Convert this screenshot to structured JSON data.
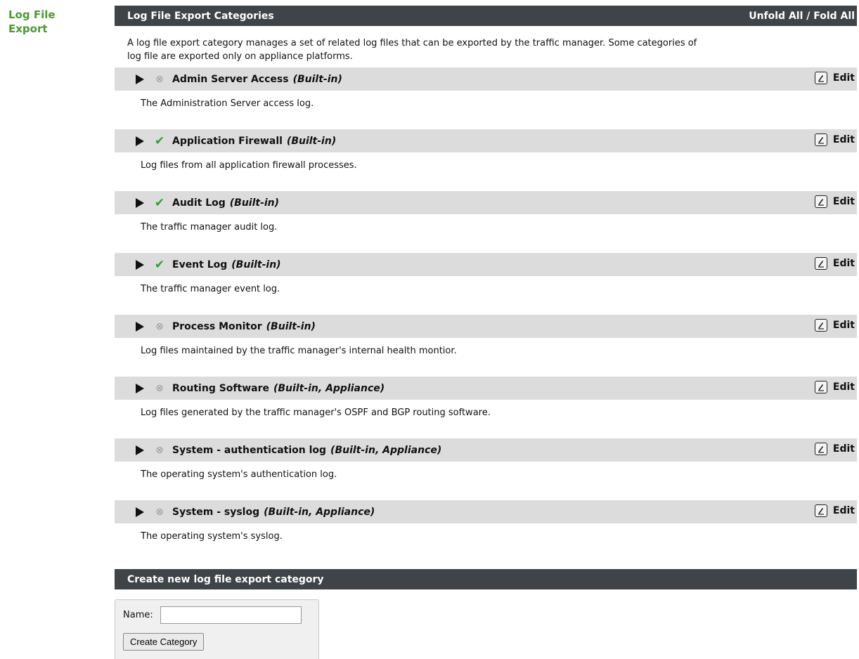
{
  "sidebar": {
    "title_line1": "Log File",
    "title_line2": "Export"
  },
  "panel": {
    "title": "Log File Export Categories",
    "unfold_fold": "Unfold All / Fold All",
    "intro_line1": "A log file export category manages a set of related log files that can be exported by the traffic manager. Some categories of",
    "intro_line2": "log file are exported only on appliance platforms."
  },
  "categories": [
    {
      "name": "Admin Server Access",
      "tag": "(Built-in)",
      "enabled": false,
      "description": "The Administration Server access log.",
      "edit_label": "Edit"
    },
    {
      "name": "Application Firewall",
      "tag": "(Built-in)",
      "enabled": true,
      "description": "Log files from all application firewall processes.",
      "edit_label": "Edit"
    },
    {
      "name": "Audit Log",
      "tag": "(Built-in)",
      "enabled": true,
      "description": "The traffic manager audit log.",
      "edit_label": "Edit"
    },
    {
      "name": "Event Log",
      "tag": "(Built-in)",
      "enabled": true,
      "description": "The traffic manager event log.",
      "edit_label": "Edit"
    },
    {
      "name": "Process Monitor",
      "tag": "(Built-in)",
      "enabled": false,
      "description": "Log files maintained by the traffic manager's internal health montior.",
      "edit_label": "Edit"
    },
    {
      "name": "Routing Software",
      "tag": "(Built-in, Appliance)",
      "enabled": false,
      "description": "Log files generated by the traffic manager's OSPF and BGP routing software.",
      "edit_label": "Edit"
    },
    {
      "name": "System - authentication log",
      "tag": "(Built-in, Appliance)",
      "enabled": false,
      "description": "The operating system's authentication log.",
      "edit_label": "Edit"
    },
    {
      "name": "System - syslog",
      "tag": "(Built-in, Appliance)",
      "enabled": false,
      "description": "The operating system's syslog.",
      "edit_label": "Edit"
    }
  ],
  "icons": {
    "expand": "play-triangle-icon",
    "enabled": "checkmark-icon",
    "disabled": "x-circle-icon",
    "edit": "pencil-icon"
  },
  "colors": {
    "header_bg": "#3e4448",
    "row_bg": "#dcdcdc",
    "enabled": "#2aa32a",
    "disabled": "#9a9a9a",
    "accent_title": "#4a9a2e"
  },
  "create": {
    "title": "Create new log file export category",
    "name_label": "Name:",
    "name_value": "",
    "button_label": "Create Category"
  }
}
